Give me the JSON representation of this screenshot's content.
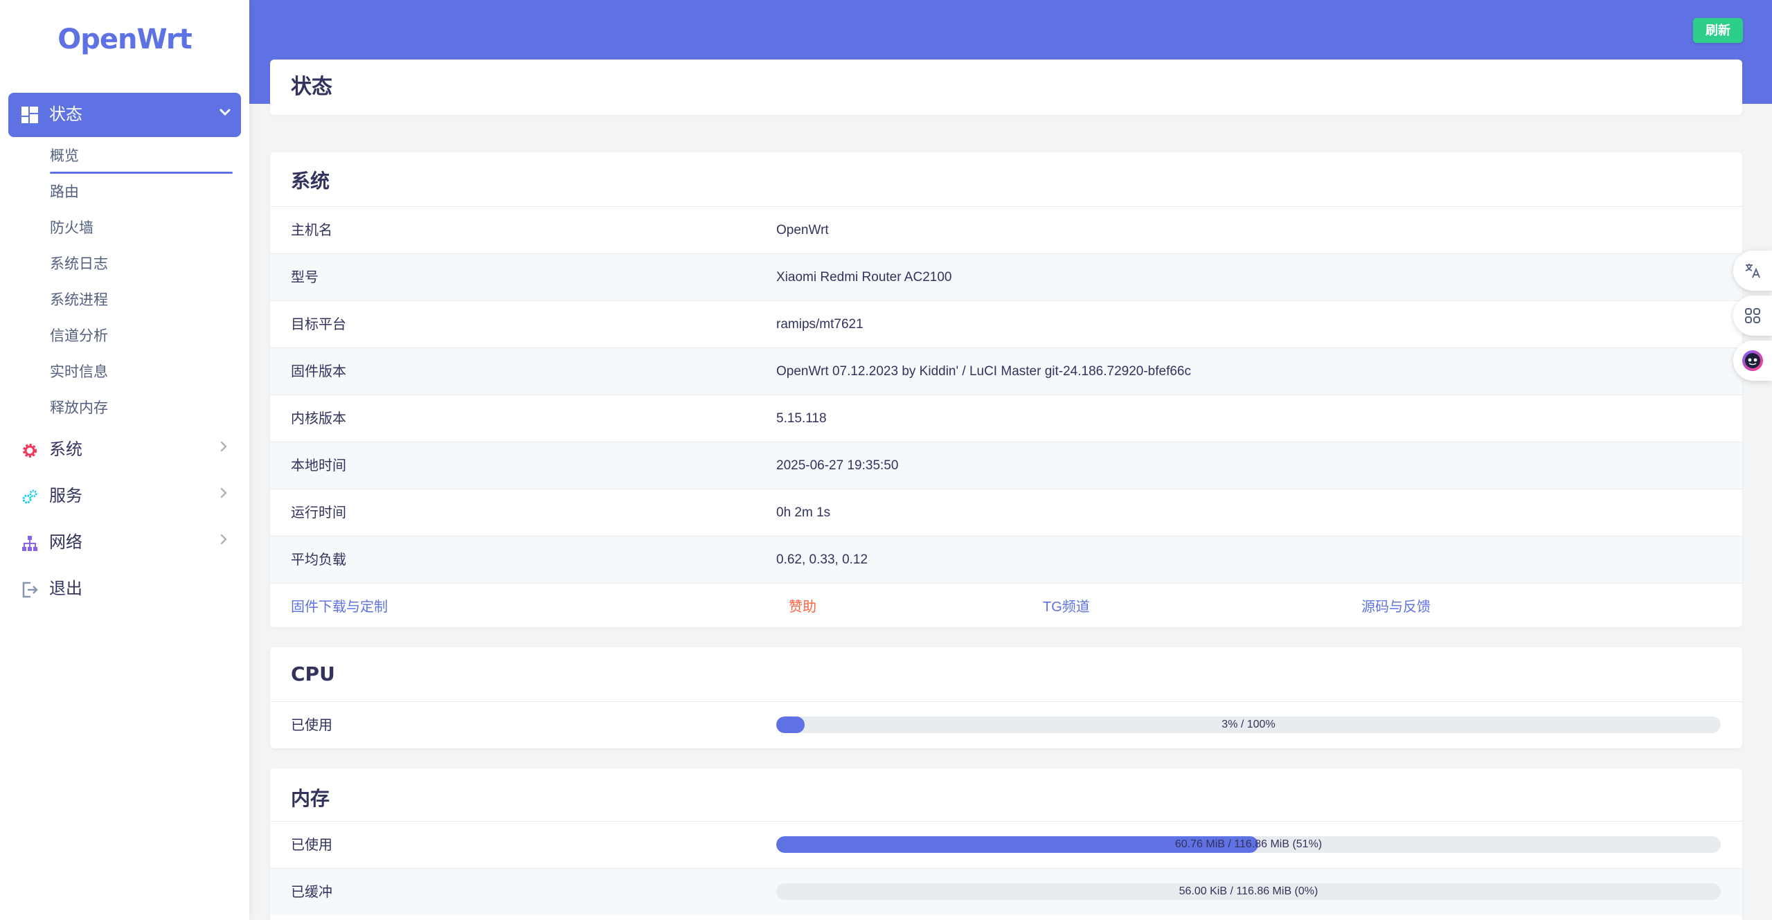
{
  "brand": "OpenWrt",
  "header": {
    "refresh_label": "刷新",
    "page_title": "状态"
  },
  "sidebar": {
    "active": {
      "label": "状态",
      "icon": "dashboard-icon"
    },
    "subitems": [
      "概览",
      "路由",
      "防火墙",
      "系统日志",
      "系统进程",
      "信道分析",
      "实时信息",
      "释放内存"
    ],
    "items": [
      {
        "label": "系统",
        "icon": "gear-icon"
      },
      {
        "label": "服务",
        "icon": "cogs-icon"
      },
      {
        "label": "网络",
        "icon": "network-icon"
      },
      {
        "label": "退出",
        "icon": "logout-icon"
      }
    ]
  },
  "system": {
    "title": "系统",
    "rows": [
      {
        "key": "主机名",
        "value": "OpenWrt"
      },
      {
        "key": "型号",
        "value": "Xiaomi Redmi Router AC2100"
      },
      {
        "key": "目标平台",
        "value": "ramips/mt7621"
      },
      {
        "key": "固件版本",
        "value": "OpenWrt 07.12.2023 by Kiddin' / LuCI Master git-24.186.72920-bfef66c"
      },
      {
        "key": "内核版本",
        "value": "5.15.118"
      },
      {
        "key": "本地时间",
        "value": "2025-06-27 19:35:50"
      },
      {
        "key": "运行时间",
        "value": "0h 2m 1s"
      },
      {
        "key": "平均负载",
        "value": "0.62, 0.33, 0.12"
      }
    ],
    "links": [
      "固件下载与定制",
      "赞助",
      "TG频道",
      "源码与反馈"
    ]
  },
  "cpu": {
    "title": "CPU",
    "used_label": "已使用",
    "used_text": "3% / 100%",
    "used_fraction": 0.03
  },
  "memory": {
    "title": "内存",
    "rows": [
      {
        "label": "已使用",
        "text": "60.76 MiB / 116.86 MiB (51%)",
        "fraction": 0.51
      },
      {
        "label": "已缓冲",
        "text": "56.00 KiB / 116.86 MiB (0%)",
        "fraction": 0.0
      }
    ]
  },
  "colors": {
    "accent": "#5e72e4",
    "success": "#2dce89",
    "warning": "#fb6340"
  },
  "floating_tools": [
    "translate-icon",
    "apps-icon",
    "assistant-icon"
  ]
}
